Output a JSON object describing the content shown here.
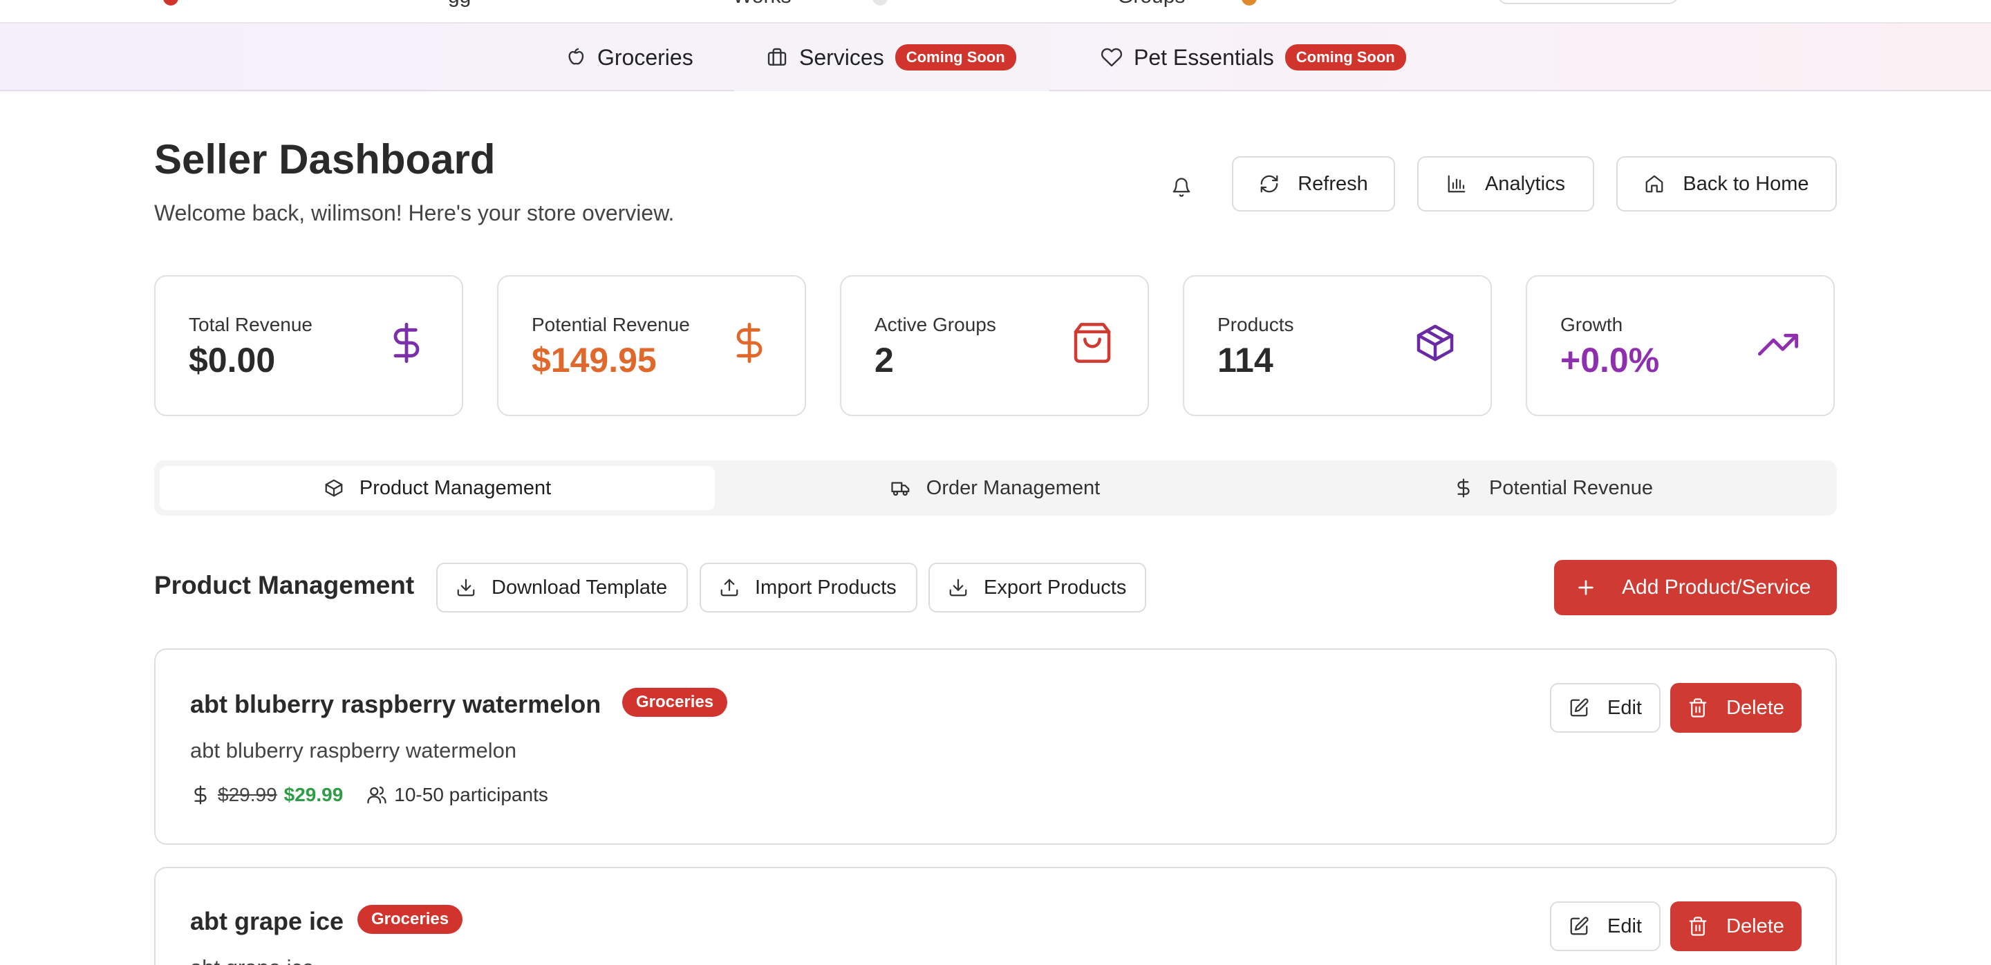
{
  "topnav": {
    "fragments": [
      "gg",
      "Works",
      "Groups"
    ]
  },
  "categories": [
    {
      "label": "Groceries",
      "icon": "apple-icon",
      "badge": ""
    },
    {
      "label": "Services",
      "icon": "briefcase-icon",
      "badge": "Coming Soon"
    },
    {
      "label": "Pet Essentials",
      "icon": "heart-icon",
      "badge": "Coming Soon"
    }
  ],
  "header": {
    "title": "Seller Dashboard",
    "subtitle": "Welcome back, wilimson! Here's your store overview.",
    "refresh_label": "Refresh",
    "analytics_label": "Analytics",
    "home_label": "Back to Home"
  },
  "stats": [
    {
      "label": "Total Revenue",
      "value": "$0.00",
      "icon": "dollar-icon",
      "color": "#2a2a2a",
      "icon_color": "#7b2fa8"
    },
    {
      "label": "Potential Revenue",
      "value": "$149.95",
      "icon": "dollar-icon",
      "color": "#e0682b",
      "icon_color": "#e0682b"
    },
    {
      "label": "Active Groups",
      "value": "2",
      "icon": "shopping-bag-icon",
      "color": "#2a2a2a",
      "icon_color": "#cf3a33"
    },
    {
      "label": "Products",
      "value": "114",
      "icon": "package-icon",
      "color": "#2a2a2a",
      "icon_color": "#6a2aa3"
    },
    {
      "label": "Growth",
      "value": "+0.0%",
      "icon": "trending-up-icon",
      "color": "#8e2fb0",
      "icon_color": "#8e2fb0"
    }
  ],
  "tabs": [
    {
      "label": "Product Management",
      "icon": "package-icon",
      "active": true
    },
    {
      "label": "Order Management",
      "icon": "truck-icon",
      "active": false
    },
    {
      "label": "Potential Revenue",
      "icon": "dollar-icon",
      "active": false
    }
  ],
  "product_management": {
    "title": "Product Management",
    "download_template": "Download Template",
    "import_products": "Import Products",
    "export_products": "Export Products",
    "add_label": "Add Product/Service"
  },
  "products": [
    {
      "name": "abt bluberry raspberry watermelon",
      "tag": "Groceries",
      "description": "abt bluberry raspberry watermelon",
      "original_price": "$29.99",
      "price": "$29.99",
      "participants": "10-50 participants",
      "edit_label": "Edit",
      "delete_label": "Delete"
    },
    {
      "name": "abt grape ice",
      "tag": "Groceries",
      "description": "abt grape ice",
      "edit_label": "Edit",
      "delete_label": "Delete"
    }
  ],
  "colors": {
    "accent_red": "#cf3a33",
    "price_green": "#2f9c46",
    "purple": "#7b2fa8",
    "orange": "#e0682b"
  }
}
